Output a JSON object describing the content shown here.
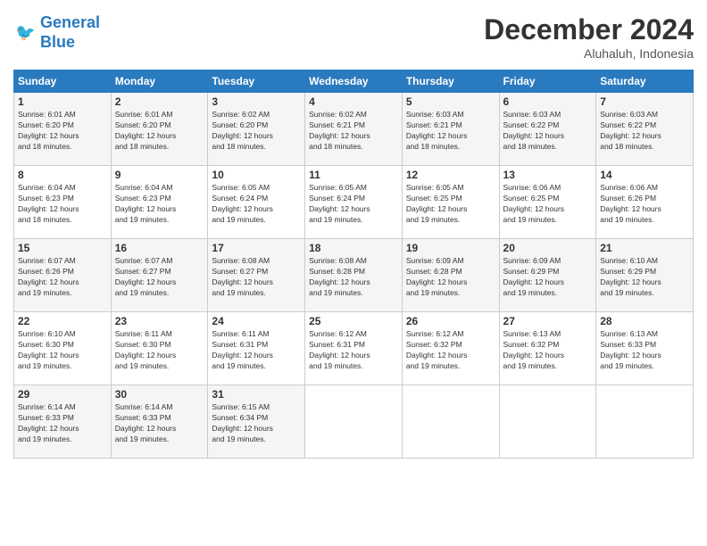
{
  "logo": {
    "line1": "General",
    "line2": "Blue"
  },
  "header": {
    "month": "December 2024",
    "location": "Aluhaluh, Indonesia"
  },
  "weekdays": [
    "Sunday",
    "Monday",
    "Tuesday",
    "Wednesday",
    "Thursday",
    "Friday",
    "Saturday"
  ],
  "weeks": [
    [
      {
        "day": "1",
        "info": "Sunrise: 6:01 AM\nSunset: 6:20 PM\nDaylight: 12 hours\nand 18 minutes."
      },
      {
        "day": "2",
        "info": "Sunrise: 6:01 AM\nSunset: 6:20 PM\nDaylight: 12 hours\nand 18 minutes."
      },
      {
        "day": "3",
        "info": "Sunrise: 6:02 AM\nSunset: 6:20 PM\nDaylight: 12 hours\nand 18 minutes."
      },
      {
        "day": "4",
        "info": "Sunrise: 6:02 AM\nSunset: 6:21 PM\nDaylight: 12 hours\nand 18 minutes."
      },
      {
        "day": "5",
        "info": "Sunrise: 6:03 AM\nSunset: 6:21 PM\nDaylight: 12 hours\nand 18 minutes."
      },
      {
        "day": "6",
        "info": "Sunrise: 6:03 AM\nSunset: 6:22 PM\nDaylight: 12 hours\nand 18 minutes."
      },
      {
        "day": "7",
        "info": "Sunrise: 6:03 AM\nSunset: 6:22 PM\nDaylight: 12 hours\nand 18 minutes."
      }
    ],
    [
      {
        "day": "8",
        "info": "Sunrise: 6:04 AM\nSunset: 6:23 PM\nDaylight: 12 hours\nand 18 minutes."
      },
      {
        "day": "9",
        "info": "Sunrise: 6:04 AM\nSunset: 6:23 PM\nDaylight: 12 hours\nand 19 minutes."
      },
      {
        "day": "10",
        "info": "Sunrise: 6:05 AM\nSunset: 6:24 PM\nDaylight: 12 hours\nand 19 minutes."
      },
      {
        "day": "11",
        "info": "Sunrise: 6:05 AM\nSunset: 6:24 PM\nDaylight: 12 hours\nand 19 minutes."
      },
      {
        "day": "12",
        "info": "Sunrise: 6:05 AM\nSunset: 6:25 PM\nDaylight: 12 hours\nand 19 minutes."
      },
      {
        "day": "13",
        "info": "Sunrise: 6:06 AM\nSunset: 6:25 PM\nDaylight: 12 hours\nand 19 minutes."
      },
      {
        "day": "14",
        "info": "Sunrise: 6:06 AM\nSunset: 6:26 PM\nDaylight: 12 hours\nand 19 minutes."
      }
    ],
    [
      {
        "day": "15",
        "info": "Sunrise: 6:07 AM\nSunset: 6:26 PM\nDaylight: 12 hours\nand 19 minutes."
      },
      {
        "day": "16",
        "info": "Sunrise: 6:07 AM\nSunset: 6:27 PM\nDaylight: 12 hours\nand 19 minutes."
      },
      {
        "day": "17",
        "info": "Sunrise: 6:08 AM\nSunset: 6:27 PM\nDaylight: 12 hours\nand 19 minutes."
      },
      {
        "day": "18",
        "info": "Sunrise: 6:08 AM\nSunset: 6:28 PM\nDaylight: 12 hours\nand 19 minutes."
      },
      {
        "day": "19",
        "info": "Sunrise: 6:09 AM\nSunset: 6:28 PM\nDaylight: 12 hours\nand 19 minutes."
      },
      {
        "day": "20",
        "info": "Sunrise: 6:09 AM\nSunset: 6:29 PM\nDaylight: 12 hours\nand 19 minutes."
      },
      {
        "day": "21",
        "info": "Sunrise: 6:10 AM\nSunset: 6:29 PM\nDaylight: 12 hours\nand 19 minutes."
      }
    ],
    [
      {
        "day": "22",
        "info": "Sunrise: 6:10 AM\nSunset: 6:30 PM\nDaylight: 12 hours\nand 19 minutes."
      },
      {
        "day": "23",
        "info": "Sunrise: 6:11 AM\nSunset: 6:30 PM\nDaylight: 12 hours\nand 19 minutes."
      },
      {
        "day": "24",
        "info": "Sunrise: 6:11 AM\nSunset: 6:31 PM\nDaylight: 12 hours\nand 19 minutes."
      },
      {
        "day": "25",
        "info": "Sunrise: 6:12 AM\nSunset: 6:31 PM\nDaylight: 12 hours\nand 19 minutes."
      },
      {
        "day": "26",
        "info": "Sunrise: 6:12 AM\nSunset: 6:32 PM\nDaylight: 12 hours\nand 19 minutes."
      },
      {
        "day": "27",
        "info": "Sunrise: 6:13 AM\nSunset: 6:32 PM\nDaylight: 12 hours\nand 19 minutes."
      },
      {
        "day": "28",
        "info": "Sunrise: 6:13 AM\nSunset: 6:33 PM\nDaylight: 12 hours\nand 19 minutes."
      }
    ],
    [
      {
        "day": "29",
        "info": "Sunrise: 6:14 AM\nSunset: 6:33 PM\nDaylight: 12 hours\nand 19 minutes."
      },
      {
        "day": "30",
        "info": "Sunrise: 6:14 AM\nSunset: 6:33 PM\nDaylight: 12 hours\nand 19 minutes."
      },
      {
        "day": "31",
        "info": "Sunrise: 6:15 AM\nSunset: 6:34 PM\nDaylight: 12 hours\nand 19 minutes."
      },
      null,
      null,
      null,
      null
    ]
  ]
}
